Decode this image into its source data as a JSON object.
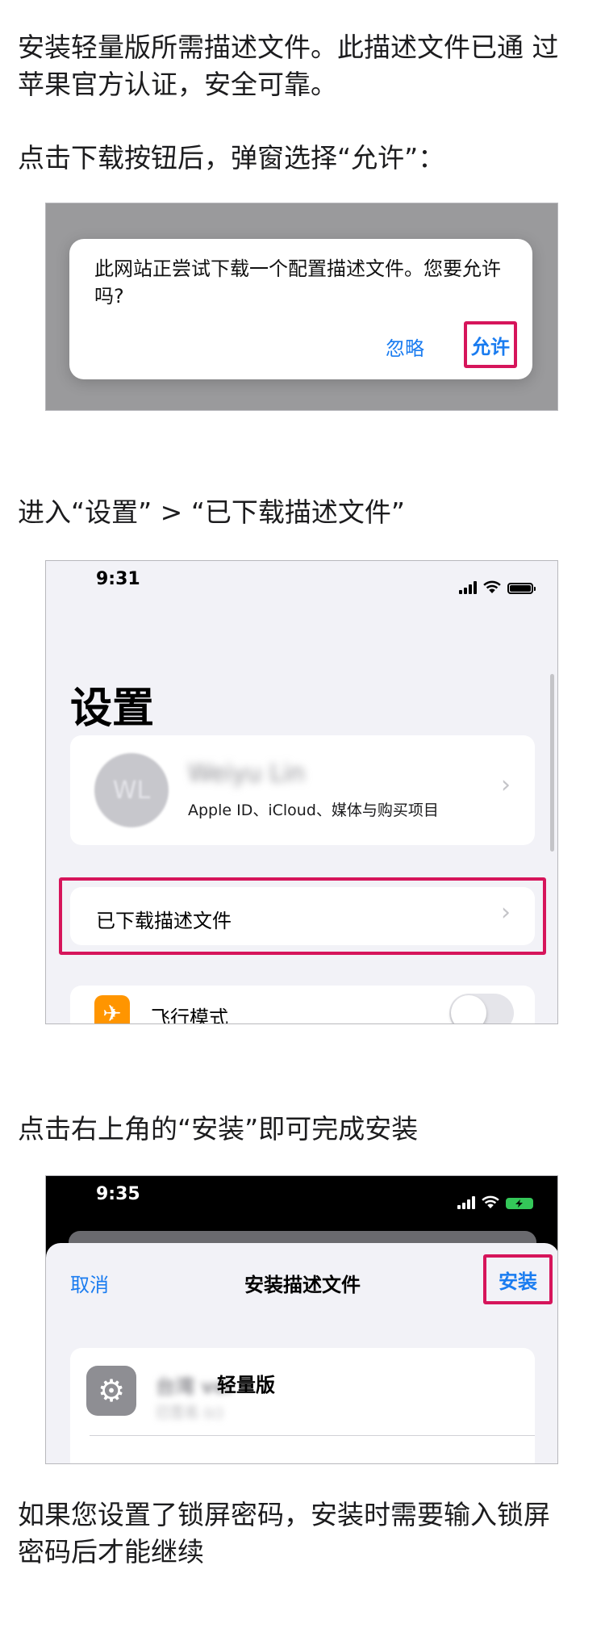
{
  "intro": {
    "line1": "安装轻量版所需描述文件。此描述文件已通 过",
    "line2": "苹果官方认证，安全可靠。",
    "step1": "点击下载按钮后，弹窗选择“允许”：",
    "step2": "进入“设置” > “已下载描述文件”",
    "step3": "点击右上角的“安装”即可完成安装",
    "outro_line1": "如果您设置了锁屏密码，安装时需要输入锁屏",
    "outro_line2": "密码后才能继续"
  },
  "dialog": {
    "message": "此网站正尝试下载一个配置描述文件。您要允许吗?",
    "ignore_label": "忽略",
    "allow_label": "允许"
  },
  "settings_screen": {
    "time": "9:31",
    "title": "设置",
    "avatar_initials": "WL",
    "account_name": "Weiyu Lin",
    "account_subtitle": "Apple ID、iCloud、媒体与购买项目",
    "downloaded_profile_label": "已下载描述文件",
    "airplane_mode_label": "飞行模式",
    "airplane_mode_on": false
  },
  "install_screen": {
    "time": "9:35",
    "cancel_label": "取消",
    "title": "安装描述文件",
    "install_label": "安装",
    "profile_prefix": "台湾 vci",
    "profile_name": "轻量版",
    "profile_sub": "已签名 (c)"
  },
  "colors": {
    "highlight": "#d6155b",
    "ios_blue": "#1a7cf0",
    "battery_charging": "#34c759"
  },
  "icons": [
    "chevron-right-icon",
    "airplane-icon",
    "gear-icon",
    "wifi-icon",
    "cellular-signal-icon",
    "battery-icon",
    "battery-charging-icon"
  ]
}
